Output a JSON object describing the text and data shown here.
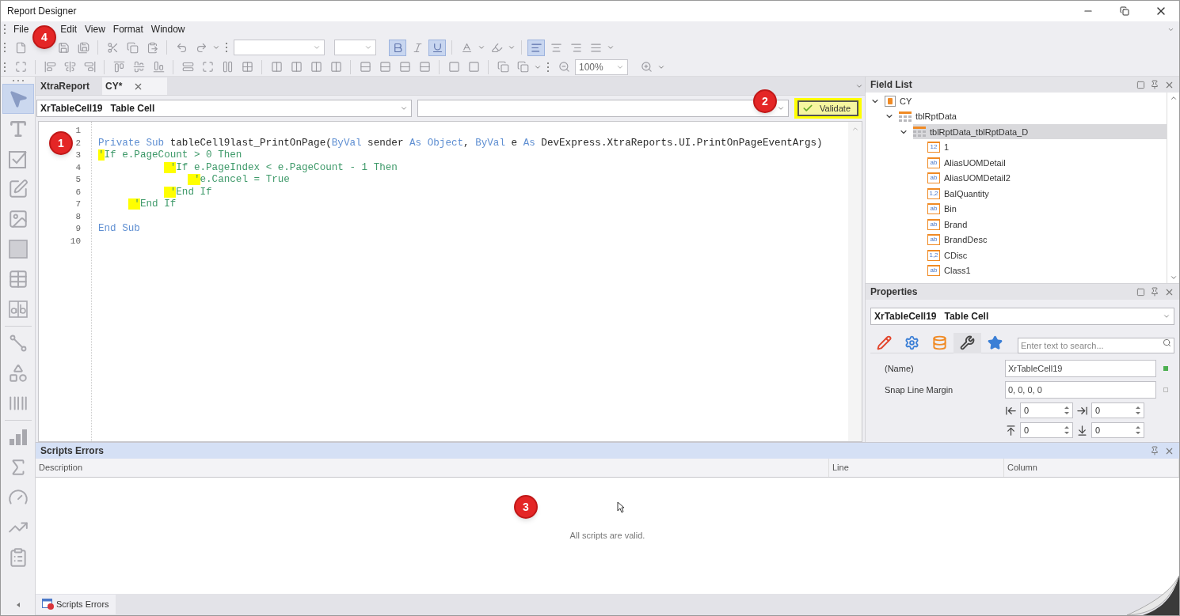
{
  "window": {
    "title": "Report Designer"
  },
  "menu": [
    "File",
    "Edit",
    "View",
    "Format",
    "Window"
  ],
  "toolbar": {
    "format_buttons": [
      {
        "kind": "bold",
        "on": true
      },
      {
        "kind": "italic",
        "on": false
      },
      {
        "kind": "underline",
        "on": true
      }
    ],
    "align_buttons": [
      {
        "kind": "left",
        "selected": true
      },
      {
        "kind": "center",
        "selected": false
      },
      {
        "kind": "right",
        "selected": false
      },
      {
        "kind": "justify",
        "selected": false
      }
    ],
    "zoom": "100%"
  },
  "toolbox": [
    {
      "kind": "pointer",
      "selected": true
    },
    {
      "kind": "label",
      "selected": false
    },
    {
      "kind": "checkbox",
      "selected": false
    },
    {
      "kind": "richtext",
      "selected": false
    },
    {
      "kind": "picture",
      "selected": false
    },
    {
      "kind": "panel",
      "selected": false
    },
    {
      "kind": "table",
      "selected": false
    },
    {
      "kind": "charcomb",
      "selected": false
    },
    {
      "kind": "line",
      "selected": false
    },
    {
      "kind": "shape",
      "selected": false
    },
    {
      "kind": "barcode",
      "selected": false
    },
    {
      "kind": "chart",
      "selected": false
    },
    {
      "kind": "summary",
      "selected": false
    },
    {
      "kind": "gauge",
      "selected": false
    },
    {
      "kind": "sparkline",
      "selected": false
    },
    {
      "kind": "subreport",
      "selected": false
    }
  ],
  "document_tabs": [
    {
      "label": "XtraReport",
      "selected": false
    },
    {
      "label": "CY*",
      "selected": true
    }
  ],
  "script_editor": {
    "component": {
      "name": "XrTableCell19",
      "type": "Table Cell"
    },
    "validate": {
      "label": "Validate",
      "highlighted": true
    },
    "lines": [
      {
        "number": "1"
      },
      {
        "number": "2",
        "tokens": [
          {
            "kind": "keyword",
            "text": "Private Sub"
          },
          {
            "kind": "plain",
            "text": " tableCell9last_PrintOnPage("
          },
          {
            "kind": "keyword",
            "text": "ByVal"
          },
          {
            "kind": "plain",
            "text": " sender "
          },
          {
            "kind": "keyword",
            "text": "As Object"
          },
          {
            "kind": "plain",
            "text": ", "
          },
          {
            "kind": "keyword",
            "text": "ByVal"
          },
          {
            "kind": "plain",
            "text": " e "
          },
          {
            "kind": "keyword",
            "text": "As"
          },
          {
            "kind": "plain",
            "text": " DevExpress.XtraReports.UI.PrintOnPageEventArgs)"
          }
        ]
      },
      {
        "number": "3",
        "tokens": [
          {
            "kind": "mark",
            "text": "'"
          },
          {
            "kind": "comment",
            "text": "If e.PageCount > 0 Then"
          }
        ]
      },
      {
        "number": "4",
        "tokens": [
          {
            "kind": "mark",
            "text": "            '"
          },
          {
            "kind": "comment",
            "text": "If e.PageIndex < e.PageCount - 1 Then"
          }
        ]
      },
      {
        "number": "5",
        "tokens": [
          {
            "kind": "mark",
            "text": "                '"
          },
          {
            "kind": "comment",
            "text": "e.Cancel = True"
          }
        ]
      },
      {
        "number": "6",
        "tokens": [
          {
            "kind": "mark",
            "text": "            '"
          },
          {
            "kind": "comment",
            "text": "End If"
          }
        ]
      },
      {
        "number": "7",
        "tokens": [
          {
            "kind": "mark",
            "text": "      '"
          },
          {
            "kind": "comment",
            "text": "End If"
          }
        ]
      },
      {
        "number": "8"
      },
      {
        "number": "9",
        "tokens": [
          {
            "kind": "keyword",
            "text": "End Sub"
          }
        ]
      },
      {
        "number": "10"
      }
    ]
  },
  "field_list": {
    "title": "Field List",
    "tree": [
      {
        "kind": "datasource",
        "label": "CY",
        "expanded": true,
        "selected": false,
        "children": [
          {
            "kind": "table",
            "label": "tblRptData",
            "expanded": true,
            "selected": false,
            "children": [
              {
                "kind": "table",
                "label": "tblRptData_tblRptData_D",
                "expanded": true,
                "selected": true,
                "children": [
                  {
                    "kind": "field",
                    "badge": "12",
                    "label": "1",
                    "selected": false
                  },
                  {
                    "kind": "field",
                    "badge": "ab",
                    "label": "AliasUOMDetail",
                    "selected": false
                  },
                  {
                    "kind": "field",
                    "badge": "ab",
                    "label": "AliasUOMDetail2",
                    "selected": false
                  },
                  {
                    "kind": "field",
                    "badge": "1,2",
                    "label": "BalQuantity",
                    "selected": false
                  },
                  {
                    "kind": "field",
                    "badge": "ab",
                    "label": "Bin",
                    "selected": false
                  },
                  {
                    "kind": "field",
                    "badge": "ab",
                    "label": "Brand",
                    "selected": false
                  },
                  {
                    "kind": "field",
                    "badge": "ab",
                    "label": "BrandDesc",
                    "selected": false
                  },
                  {
                    "kind": "field",
                    "badge": "1,2",
                    "label": "CDisc",
                    "selected": false
                  },
                  {
                    "kind": "field",
                    "badge": "ab",
                    "label": "Class1",
                    "selected": false
                  }
                ]
              }
            ]
          }
        ]
      }
    ]
  },
  "properties": {
    "title": "Properties",
    "component": {
      "name": "XrTableCell19",
      "type": "Table Cell"
    },
    "tabs": [
      {
        "kind": "appearance",
        "selected": false
      },
      {
        "kind": "behavior",
        "selected": false
      },
      {
        "kind": "data",
        "selected": false
      },
      {
        "kind": "layout",
        "selected": true
      },
      {
        "kind": "favorites",
        "selected": false
      }
    ],
    "search_placeholder": "Enter text to search...",
    "rows": [
      {
        "kind": "text",
        "label": "(Name)",
        "value": "XrTableCell19",
        "modified": true
      },
      {
        "kind": "text",
        "label": "Snap Line Margin",
        "value": "0, 0, 0, 0",
        "modified": false
      },
      {
        "kind": "spin_pair",
        "fields": [
          {
            "kind": "left",
            "value": "0"
          },
          {
            "kind": "right",
            "value": "0"
          }
        ]
      },
      {
        "kind": "spin_pair",
        "fields": [
          {
            "kind": "top",
            "value": "0"
          },
          {
            "kind": "bottom",
            "value": "0"
          }
        ]
      }
    ]
  },
  "scripts_errors": {
    "title": "Scripts Errors",
    "columns": [
      "Description",
      "Line",
      "Column"
    ],
    "message": "All scripts are valid."
  },
  "bottom_tabs": [
    {
      "label": "Scripts Errors",
      "selected": true
    }
  ],
  "annotations": [
    {
      "label": "1"
    },
    {
      "label": "2"
    },
    {
      "label": "3"
    },
    {
      "label": "4"
    }
  ]
}
